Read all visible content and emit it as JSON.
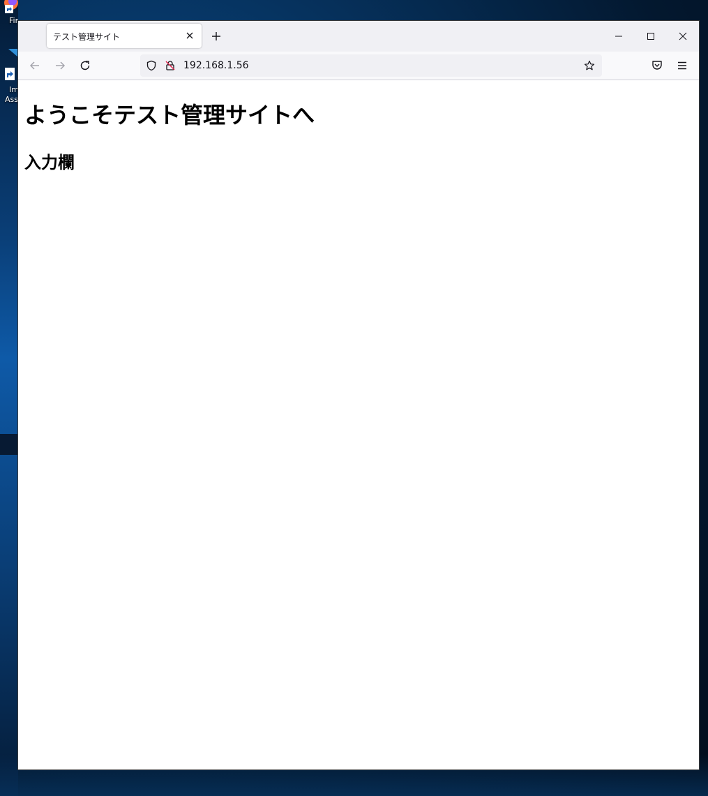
{
  "desktop": {
    "icons": [
      {
        "label": "Firefox",
        "icon": "firefox-icon"
      },
      {
        "label_line1": "Im",
        "label_line2": "Ass",
        "icon": "app-shortcut-icon"
      }
    ]
  },
  "browser": {
    "tab": {
      "title": "テスト管理サイト"
    },
    "address": {
      "url": "192.168.1.56"
    },
    "icons": {
      "back": "back-arrow-icon",
      "forward": "forward-arrow-icon",
      "reload": "reload-icon",
      "shield": "tracking-protection-shield-icon",
      "lock": "insecure-lock-icon",
      "bookmark": "bookmark-star-icon",
      "pocket": "pocket-icon",
      "menu": "hamburger-menu-icon",
      "minimize": "minimize-icon",
      "maximize": "maximize-icon",
      "close": "close-icon",
      "new_tab": "plus-icon"
    }
  },
  "page": {
    "heading": "ようこそテスト管理サイトへ",
    "subheading": "入力欄"
  }
}
